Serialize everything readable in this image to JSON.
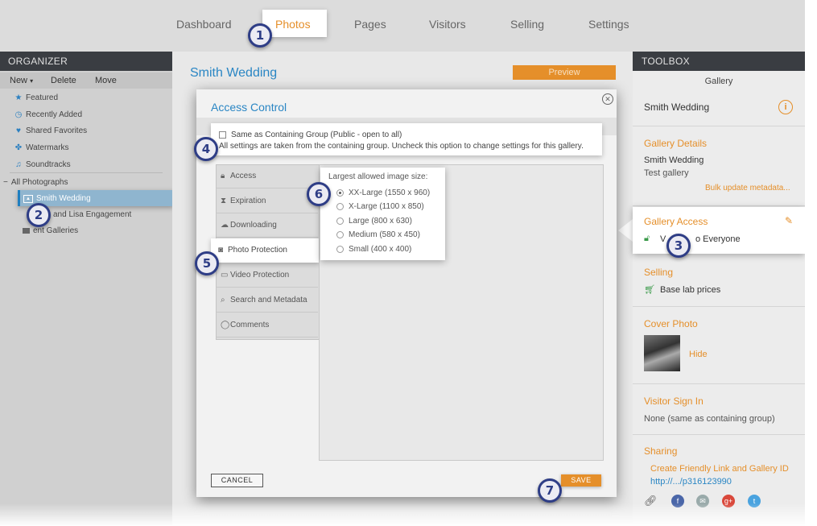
{
  "nav": {
    "dashboard": "Dashboard",
    "photos": "Photos",
    "pages": "Pages",
    "visitors": "Visitors",
    "selling": "Selling",
    "settings": "Settings"
  },
  "organizer": {
    "title": "ORGANIZER",
    "toolbar": {
      "new": "New",
      "new_caret": "▾",
      "delete": "Delete",
      "move": "Move"
    },
    "items": {
      "featured": "Featured",
      "recent": "Recently Added",
      "favorites": "Shared Favorites",
      "watermarks": "Watermarks",
      "soundtracks": "Soundtracks"
    },
    "all_photos": "All Photographs",
    "galleries": {
      "smith": "Smith Wedding",
      "engagement": "and Lisa Engagement",
      "client": "ent Galleries"
    }
  },
  "main": {
    "gallery_title": "Smith Wedding",
    "preview_label": "Preview"
  },
  "dialog": {
    "title": "Access Control",
    "close_glyph": "⊗",
    "inherit_label": "Same as Containing Group (Public - open to all)",
    "inherit_desc": "All settings are taken from the containing group. Uncheck this option to change settings for this gallery.",
    "tabs": {
      "access": "Access",
      "expiration": "Expiration",
      "downloading": "Downloading",
      "photo_protection": "Photo Protection",
      "video_protection": "Video Protection",
      "search": "Search and Metadata",
      "comments": "Comments"
    },
    "size_heading": "Largest allowed image size:",
    "sizes": {
      "xxl": "XX-Large (1550 x 960)",
      "xl": "X-Large (1100 x 850)",
      "l": "Large (800 x 630)",
      "m": "Medium (580 x 450)",
      "s": "Small (400 x 400)"
    },
    "selected_size": "XX-Large (1550 x 960)",
    "cancel": "CANCEL",
    "save": "SAVE"
  },
  "toolbox": {
    "title": "TOOLBOX",
    "subtitle": "Gallery",
    "gallery_name": "Smith Wedding",
    "details_title": "Gallery Details",
    "details_name": "Smith Wedding",
    "details_desc": "Test gallery",
    "bulk_link": "Bulk update metadata...",
    "access_title": "Gallery Access",
    "access_value_a": "V",
    "access_value_b": "o Everyone",
    "selling_title": "Selling",
    "selling_value": "Base lab prices",
    "cover_title": "Cover Photo",
    "cover_hide": "Hide",
    "signin_title": "Visitor Sign In",
    "signin_value": "None (same as containing group)",
    "sharing_title": "Sharing",
    "sharing_link": "Create Friendly Link and Gallery ID",
    "sharing_url": "http://.../p316123990"
  },
  "callouts": [
    "1",
    "2",
    "3",
    "4",
    "5",
    "6",
    "7"
  ],
  "colors": {
    "accent": "#e58f2a",
    "link_blue": "#2a86c4",
    "callout": "#2e3d86",
    "header_dark": "#3a3d42"
  }
}
